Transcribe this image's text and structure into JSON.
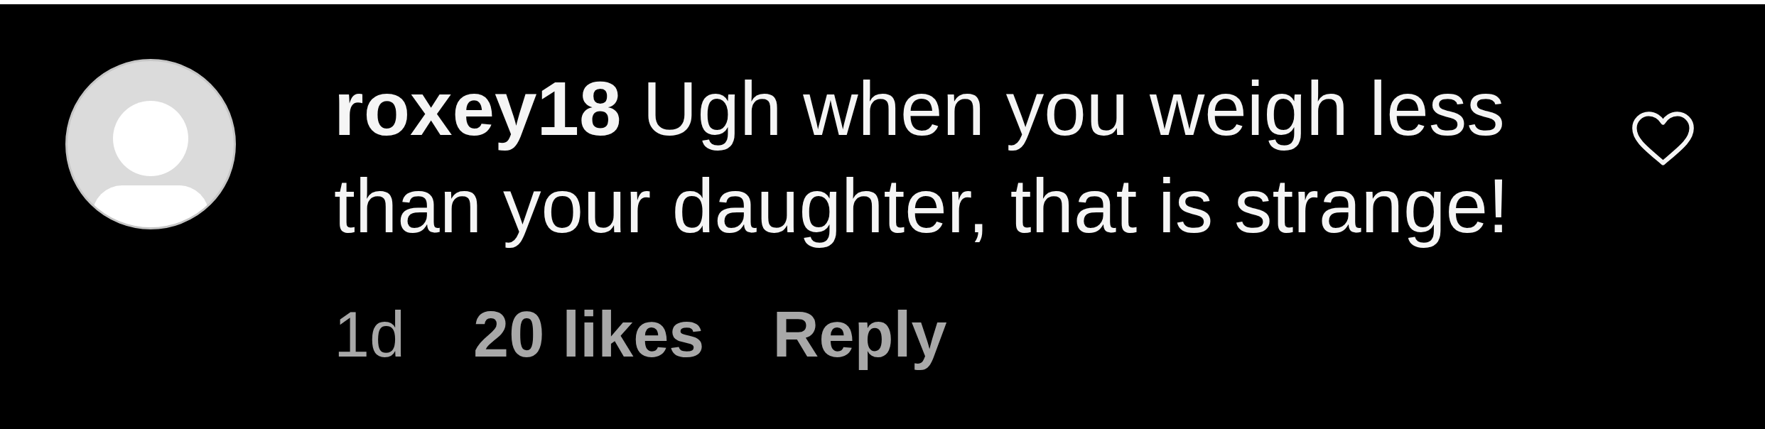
{
  "comment": {
    "username": "roxey18",
    "text": "Ugh when you weigh less than your daughter, that is strange!",
    "time": "1d",
    "likes": "20 likes",
    "reply": "Reply",
    "liked": false
  }
}
